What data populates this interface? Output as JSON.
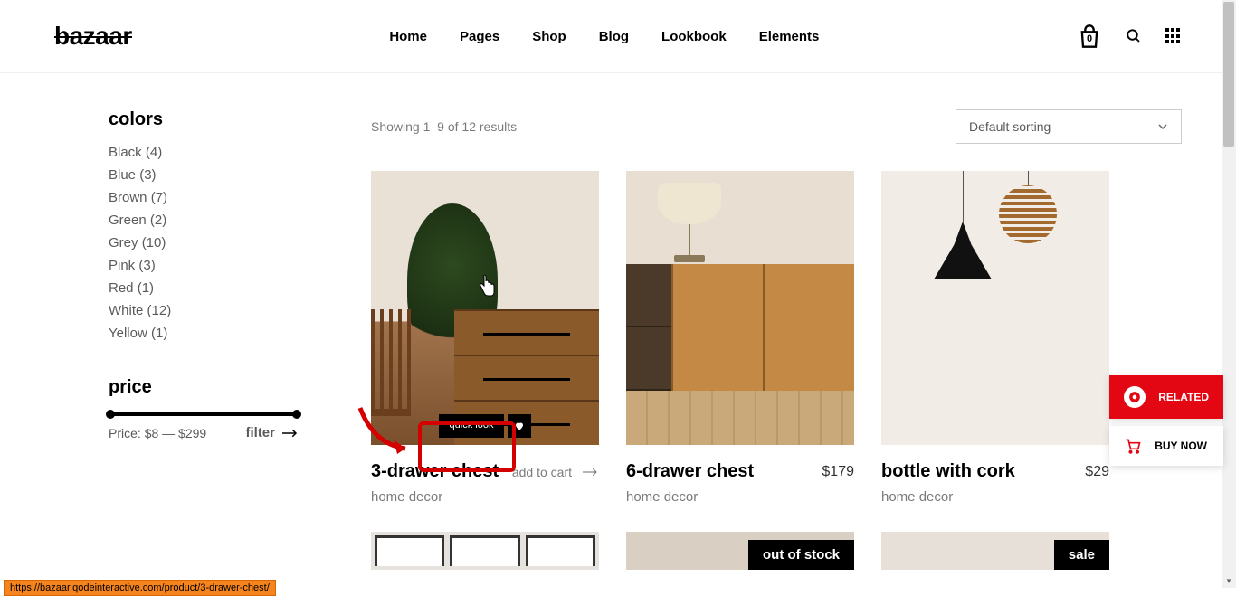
{
  "brand": "bazaar",
  "nav": [
    "Home",
    "Pages",
    "Shop",
    "Blog",
    "Lookbook",
    "Elements"
  ],
  "cart_count": "0",
  "sidebar": {
    "colors_title": "colors",
    "colors": [
      {
        "name": "Black",
        "count": "(4)"
      },
      {
        "name": "Blue",
        "count": "(3)"
      },
      {
        "name": "Brown",
        "count": "(7)"
      },
      {
        "name": "Green",
        "count": "(2)"
      },
      {
        "name": "Grey",
        "count": "(10)"
      },
      {
        "name": "Pink",
        "count": "(3)"
      },
      {
        "name": "Red",
        "count": "(1)"
      },
      {
        "name": "White",
        "count": "(12)"
      },
      {
        "name": "Yellow",
        "count": "(1)"
      }
    ],
    "price_title": "price",
    "price_label": "Price: ",
    "price_min": "$8",
    "price_sep": " — ",
    "price_max": "$299",
    "filter_label": "filter"
  },
  "results_text": "Showing 1–9 of 12 results",
  "sort_label": "Default sorting",
  "products": [
    {
      "title": "3-drawer chest",
      "price": "",
      "cat": "home decor",
      "cta": "add to cart",
      "quick": "quick look"
    },
    {
      "title": "6-drawer chest",
      "price": "$179",
      "cat": "home decor"
    },
    {
      "title": "bottle with cork",
      "price": "$29",
      "cat": "home decor"
    }
  ],
  "badges": {
    "outofstock": "out of stock",
    "sale": "sale"
  },
  "side": {
    "related": "RELATED",
    "buy": "BUY NOW"
  },
  "url": "https://bazaar.qodeinteractive.com/product/3-drawer-chest/"
}
